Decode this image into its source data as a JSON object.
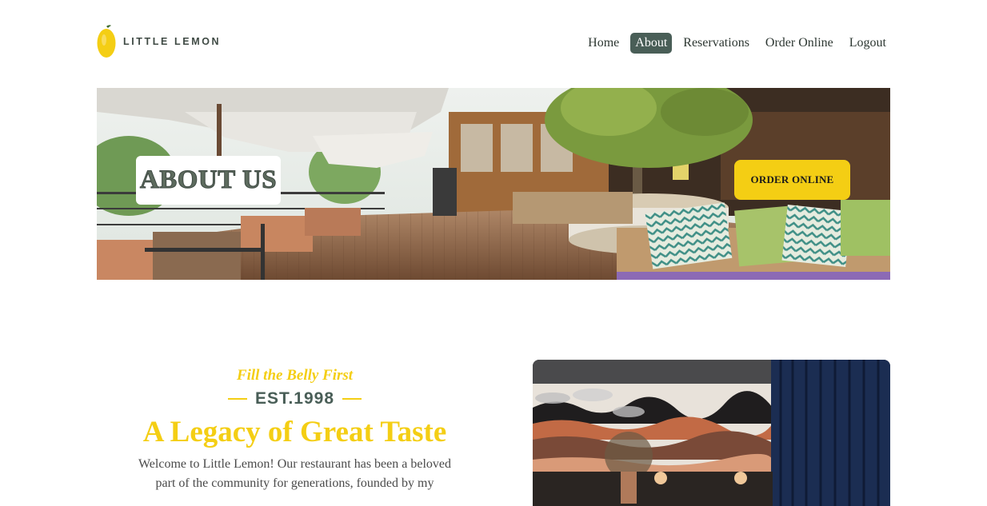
{
  "brand": {
    "name": "LITTLE LEMON",
    "logo_icon": "lemon-icon"
  },
  "nav": {
    "items": [
      {
        "label": "Home",
        "active": false
      },
      {
        "label": "About",
        "active": true
      },
      {
        "label": "Reservations",
        "active": false
      },
      {
        "label": "Order Online",
        "active": false
      },
      {
        "label": "Logout",
        "active": false
      }
    ]
  },
  "hero": {
    "badge": "ABOUT US",
    "cta": "ORDER ONLINE"
  },
  "story": {
    "tagline": "Fill the Belly First",
    "established": "EST.1998",
    "heading": "A Legacy of Great Taste",
    "body": "Welcome to Little Lemon! Our restaurant has been a beloved part of the community for generations, founded by my"
  },
  "colors": {
    "primary_green": "#495e57",
    "accent_yellow": "#f4ce14"
  }
}
